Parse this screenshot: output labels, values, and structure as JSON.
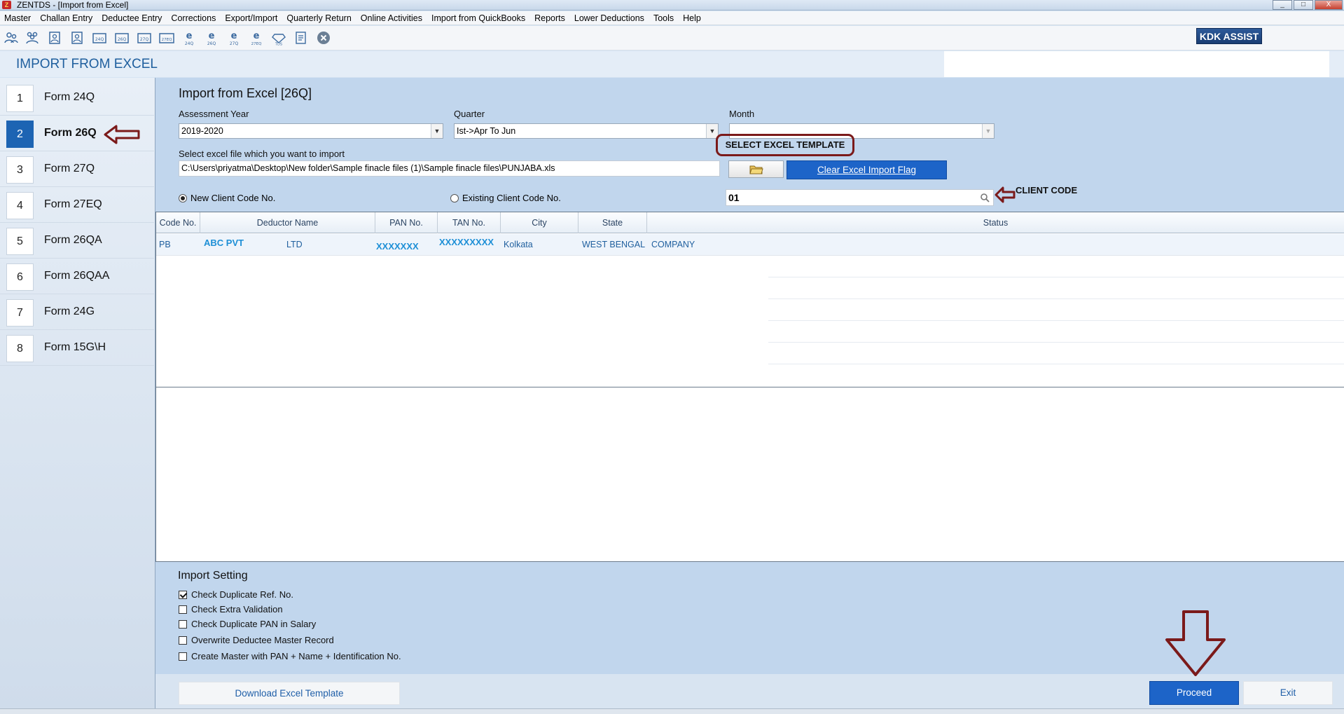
{
  "window": {
    "title": "ZENTDS - [Import from Excel]",
    "controls": [
      "_",
      "□",
      "X"
    ]
  },
  "menu": [
    "Master",
    "Challan Entry",
    "Deductee Entry",
    "Corrections",
    "Export/Import",
    "Quarterly Return",
    "Online Activities",
    "Import from QuickBooks",
    "Reports",
    "Lower Deductions",
    "Tools",
    "Help"
  ],
  "toolbar": {
    "kdk_assist": "KDK ASSIST",
    "icon_labels": [
      "24Q",
      "26Q",
      "27Q",
      "27EQ",
      "24Q",
      "26Q",
      "27Q",
      "27EQ",
      "TDS"
    ]
  },
  "page_title": "IMPORT FROM EXCEL",
  "sidebar": {
    "items": [
      {
        "num": "1",
        "label": "Form 24Q"
      },
      {
        "num": "2",
        "label": "Form 26Q"
      },
      {
        "num": "3",
        "label": "Form 27Q"
      },
      {
        "num": "4",
        "label": "Form 27EQ"
      },
      {
        "num": "5",
        "label": "Form 26QA"
      },
      {
        "num": "6",
        "label": "Form 26QAA"
      },
      {
        "num": "7",
        "label": "Form 24G"
      },
      {
        "num": "8",
        "label": "Form 15G\\H"
      }
    ]
  },
  "form": {
    "title": "Import from Excel [26Q]",
    "assessment_year_label": "Assessment Year",
    "assessment_year_value": "2019-2020",
    "quarter_label": "Quarter",
    "quarter_value": "Ist->Apr To Jun",
    "month_label": "Month",
    "month_value": "",
    "file_label": "Select excel file which you want to import",
    "file_path": "C:\\Users\\priyatma\\Desktop\\New folder\\Sample finacle files (1)\\Sample finacle files\\PUNJABA.xls",
    "clear_flag_label": "Clear Excel Import Flag",
    "new_client_label": "New Client Code No.",
    "existing_client_label": "Existing Client Code No.",
    "client_code_value": "01"
  },
  "annotations": {
    "select_template": "SELECT EXCEL TEMPLATE",
    "client_code": "CLIENT CODE"
  },
  "grid": {
    "headers": [
      "Code No.",
      "Deductor Name",
      "PAN No.",
      "TAN No.",
      "City",
      "State",
      "Status"
    ],
    "row": {
      "code": "PB",
      "name_part1": "ABC PVT",
      "name_part2": "LTD",
      "pan": "XXXXXXX",
      "tan": "XXXXXXXXX",
      "city": "Kolkata",
      "state": "WEST BENGAL",
      "status": "COMPANY"
    }
  },
  "import_setting": {
    "title": "Import Setting",
    "options": [
      {
        "label": "Check Duplicate Ref. No.",
        "checked": true
      },
      {
        "label": "Check Extra Validation",
        "checked": false
      },
      {
        "label": "Check Duplicate PAN in Salary",
        "checked": false
      },
      {
        "label": "Overwrite Deductee Master Record",
        "checked": false
      },
      {
        "label": "Create Master with PAN + Name + Identification No.",
        "checked": false
      }
    ]
  },
  "footer": {
    "download_template": "Download Excel Template",
    "proceed": "Proceed",
    "exit": "Exit"
  },
  "colors": {
    "accent_blue": "#1d64c8",
    "annotation_maroon": "#7b1a1a",
    "panel_bg": "#c1d6ed"
  }
}
